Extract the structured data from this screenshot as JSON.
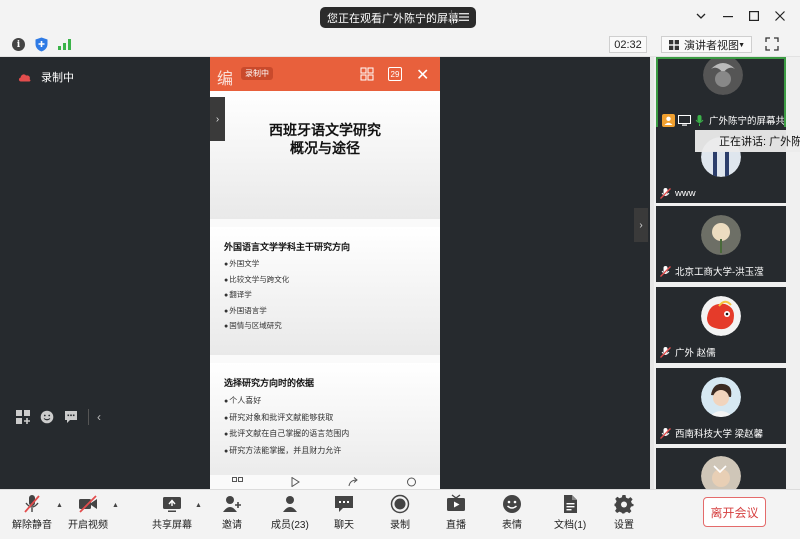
{
  "titlebar": {
    "share_status": "您正在观看广外陈宁的屏幕",
    "window_controls": [
      "minimize-icon",
      "maximize-icon",
      "close-icon",
      "dropdown-icon"
    ]
  },
  "statusbar": {
    "timer": "02:32",
    "view_mode": "演讲者视图"
  },
  "stage": {
    "recording_label": "录制中"
  },
  "slide": {
    "recording_tag": "录制中",
    "edit_label": "编",
    "page_number": "29",
    "page1_title_line1": "西班牙语文学研究",
    "page1_title_line2": "概况与途径",
    "page2_heading": "外国语言文学学科主干研究方向",
    "page2_items": [
      "外国文学",
      "比较文学与跨文化",
      "翻译学",
      "外国语言学",
      "国情与区域研究"
    ],
    "page3_heading": "选择研究方向时的依据",
    "page3_items": [
      "个人喜好",
      "研究对象和批评文献能够获取",
      "批评文献在自己掌握的语言范围内",
      "研究方法能掌握，并且财力允许"
    ]
  },
  "participants": {
    "speaking_now": "正在讲话: 广外陈宁",
    "tiles": [
      {
        "name": "广外陈宁的屏幕共享",
        "active": true
      },
      {
        "name": "www"
      },
      {
        "name": "北京工商大学-洪玉滢"
      },
      {
        "name": "广外 赵儒"
      },
      {
        "name": "西南科技大学 梁赵馨"
      }
    ]
  },
  "toolbar": {
    "unmute": "解除静音",
    "start_video": "开启视频",
    "share_screen": "共享屏幕",
    "invite": "邀请",
    "members": "成员(23)",
    "chat": "聊天",
    "record": "录制",
    "live": "直播",
    "reactions": "表情",
    "documents": "文档(1)",
    "settings": "设置",
    "leave": "离开会议"
  },
  "colors": {
    "accent_orange": "#e8603c",
    "active_green": "#3b9b43",
    "leave_red": "#d64040",
    "stage_bg": "#262a2e"
  }
}
